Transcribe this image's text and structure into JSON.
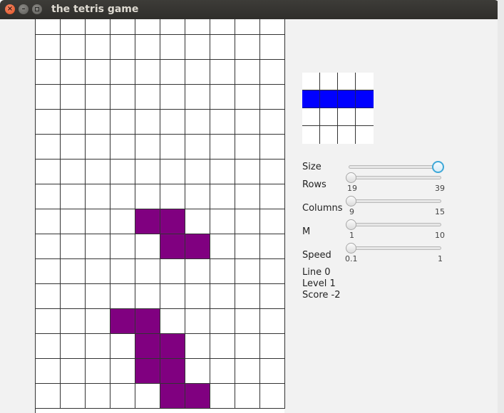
{
  "window": {
    "title": "the tetris game",
    "close_glyph": "×",
    "minimize_glyph": "–"
  },
  "board": {
    "columns": 10,
    "visible_rows": 16,
    "piece_color": "#800080",
    "filled_cells": [
      [
        8,
        4
      ],
      [
        8,
        5
      ],
      [
        9,
        5
      ],
      [
        9,
        6
      ],
      [
        12,
        3
      ],
      [
        12,
        4
      ],
      [
        13,
        4
      ],
      [
        13,
        5
      ],
      [
        14,
        4
      ],
      [
        14,
        5
      ],
      [
        15,
        5
      ],
      [
        15,
        6
      ]
    ]
  },
  "preview": {
    "size": 4,
    "piece_color": "#0000ff",
    "filled_cells": [
      [
        1,
        0
      ],
      [
        1,
        1
      ],
      [
        1,
        2
      ],
      [
        1,
        3
      ]
    ]
  },
  "controls": {
    "size": {
      "label": "Size",
      "value_fraction": 1.0
    },
    "rows": {
      "label": "Rows",
      "min": "19",
      "max": "39",
      "value_fraction": 0.0
    },
    "columns": {
      "label": "Columns",
      "min": "9",
      "max": "15",
      "value_fraction": 0.0
    },
    "m": {
      "label": "M",
      "min": "1",
      "max": "10",
      "value_fraction": 0.0
    },
    "speed": {
      "label": "Speed",
      "min": "0.1",
      "max": "1",
      "value_fraction": 0.0
    }
  },
  "stats": {
    "line": "Line 0",
    "level": "Level 1",
    "score": "Score -2"
  },
  "accent_color": "#3ea8d8"
}
